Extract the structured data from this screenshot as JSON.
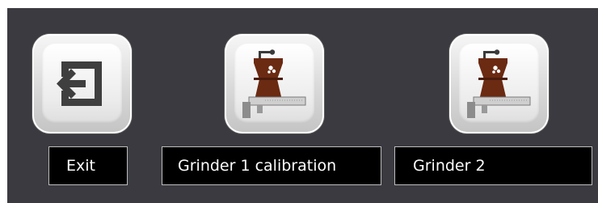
{
  "buttons": [
    {
      "label": "Exit",
      "icon": "exit-icon"
    },
    {
      "label": "Grinder 1 calibration",
      "icon": "grinder-calibration-icon"
    },
    {
      "label": "Grinder 2",
      "icon": "grinder-calibration-icon"
    }
  ],
  "colors": {
    "background": "#3a3a40",
    "label_background": "#000000",
    "label_text": "#ffffff",
    "grinder_brown": "#6b2a12",
    "exit_icon": "#3f3f3f"
  }
}
